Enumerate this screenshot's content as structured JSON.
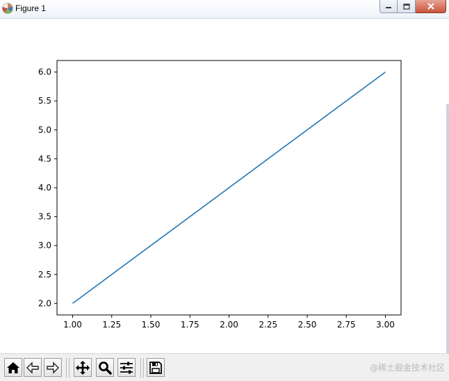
{
  "window": {
    "title": "Figure 1",
    "controls": {
      "minimize": "minimize",
      "maximize": "maximize",
      "close": "close"
    }
  },
  "toolbar": {
    "buttons": [
      {
        "name": "home-button",
        "icon": "home-icon"
      },
      {
        "name": "back-button",
        "icon": "back-arrow-icon"
      },
      {
        "name": "forward-button",
        "icon": "forward-arrow-icon"
      },
      {
        "name": "pan-button",
        "icon": "pan-move-icon"
      },
      {
        "name": "zoom-button",
        "icon": "magnifier-icon"
      },
      {
        "name": "configure-subplots-button",
        "icon": "sliders-icon"
      },
      {
        "name": "save-button",
        "icon": "floppy-disk-icon"
      }
    ]
  },
  "watermark": "@稀土掘金技术社区",
  "chart_data": {
    "type": "line",
    "x": [
      1.0,
      3.0
    ],
    "series": [
      {
        "values": [
          2.0,
          6.0
        ],
        "color": "#1f77b4"
      }
    ],
    "xlim": [
      0.9,
      3.1
    ],
    "ylim": [
      1.8,
      6.2
    ],
    "xticks": [
      1.0,
      1.25,
      1.5,
      1.75,
      2.0,
      2.25,
      2.5,
      2.75,
      3.0
    ],
    "xtick_labels": [
      "1.00",
      "1.25",
      "1.50",
      "1.75",
      "2.00",
      "2.25",
      "2.50",
      "2.75",
      "3.00"
    ],
    "yticks": [
      2.0,
      2.5,
      3.0,
      3.5,
      4.0,
      4.5,
      5.0,
      5.5,
      6.0
    ],
    "ytick_labels": [
      "2.0",
      "2.5",
      "3.0",
      "3.5",
      "4.0",
      "4.5",
      "5.0",
      "5.5",
      "6.0"
    ],
    "grid": false,
    "title": "",
    "xlabel": "",
    "ylabel": ""
  }
}
